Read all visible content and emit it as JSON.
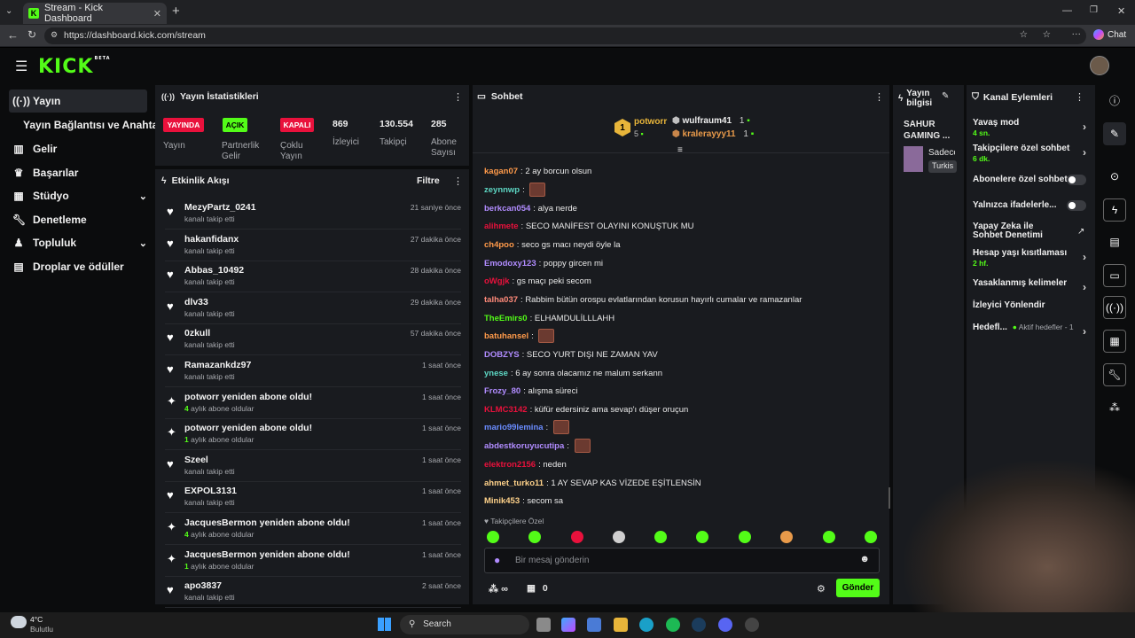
{
  "browser": {
    "tab_title": "Stream - Kick Dashboard",
    "url": "https://dashboard.kick.com/stream",
    "chat_button": "Chat"
  },
  "logo": {
    "text": "KICK",
    "beta": "BETA"
  },
  "sidebar": {
    "items": [
      {
        "label": "Yayın",
        "icon": "broadcast-icon"
      },
      {
        "label": "Yayın Bağlantısı ve Anahtarı",
        "icon": ""
      },
      {
        "label": "Gelir",
        "icon": "bar-chart-icon"
      },
      {
        "label": "Başarılar",
        "icon": "trophy-icon"
      },
      {
        "label": "Stüdyo",
        "icon": "grid-icon"
      },
      {
        "label": "Denetleme",
        "icon": "wrench-icon"
      },
      {
        "label": "Topluluk",
        "icon": "users-icon"
      },
      {
        "label": "Droplar ve ödüller",
        "icon": "gift-icon"
      }
    ]
  },
  "stats": {
    "title": "Yayın İstatistikleri",
    "badges": [
      {
        "badge": "YAYINDA",
        "label": "Yayın",
        "color": "#e9113c"
      },
      {
        "badge": "AÇIK",
        "label": "Partnerlik Gelir",
        "color": "#53fc18"
      },
      {
        "badge": "KAPALI",
        "label": "Çoklu Yayın",
        "color": "#e9113c"
      }
    ],
    "numbers": [
      {
        "value": "869",
        "label": "İzleyici"
      },
      {
        "value": "130.554",
        "label": "Takipçi"
      },
      {
        "value": "285",
        "label": "Abone Sayısı"
      }
    ]
  },
  "activity": {
    "title": "Etkinlik Akışı",
    "filter": "Filtre",
    "events": [
      {
        "name": "MezyPartz_0241",
        "sub": "kanalı takip etti",
        "time": "21 saniye önce",
        "type": "follow"
      },
      {
        "name": "hakanfidanx",
        "sub": "kanalı takip etti",
        "time": "27 dakika önce",
        "type": "follow"
      },
      {
        "name": "Abbas_10492",
        "sub": "kanalı takip etti",
        "time": "28 dakika önce",
        "type": "follow"
      },
      {
        "name": "dlv33",
        "sub": "kanalı takip etti",
        "time": "29 dakika önce",
        "type": "follow"
      },
      {
        "name": "0zkull",
        "sub": "kanalı takip etti",
        "time": "57 dakika önce",
        "type": "follow"
      },
      {
        "name": "Ramazankdz97",
        "sub": "kanalı takip etti",
        "time": "1 saat önce",
        "type": "follow"
      },
      {
        "name": "potworr yeniden abone oldu!",
        "months": "4",
        "sub": "aylık abone oldular",
        "time": "1 saat önce",
        "type": "sub"
      },
      {
        "name": "potworr yeniden abone oldu!",
        "months": "1",
        "sub": "aylık abone oldular",
        "time": "1 saat önce",
        "type": "sub"
      },
      {
        "name": "Szeel",
        "sub": "kanalı takip etti",
        "time": "1 saat önce",
        "type": "follow"
      },
      {
        "name": "EXPOL3131",
        "sub": "kanalı takip etti",
        "time": "1 saat önce",
        "type": "follow"
      },
      {
        "name": "JacquesBermon yeniden abone oldu!",
        "months": "4",
        "sub": "aylık abone oldular",
        "time": "1 saat önce",
        "type": "sub"
      },
      {
        "name": "JacquesBermon yeniden abone oldu!",
        "months": "1",
        "sub": "aylık abone oldular",
        "time": "1 saat önce",
        "type": "sub"
      },
      {
        "name": "apo3837",
        "sub": "kanalı takip etti",
        "time": "2 saat önce",
        "type": "follow"
      }
    ]
  },
  "chat": {
    "title": "Sohbet",
    "leaderboard": {
      "first": {
        "rank": "1",
        "name": "potworr",
        "count": "5"
      },
      "others": [
        {
          "name": "wulfraum41",
          "count": "1"
        },
        {
          "name": "kralerayyy11",
          "count": "1"
        }
      ]
    },
    "messages": [
      {
        "user": "kagan07",
        "text": "2 ay borcun olsun",
        "color": "#ff9a4a"
      },
      {
        "user": "zeynnwp",
        "text": "",
        "color": "#5dd6c3",
        "emote": true
      },
      {
        "user": "berkcan054",
        "text": "alya nerde",
        "color": "#b18cff"
      },
      {
        "user": "alihmete",
        "text": "SECO MANİFEST OLAYINI KONUŞTUK MU",
        "color": "#e9113c"
      },
      {
        "user": "ch4poo",
        "text": "seco gs macı neydi öyle la",
        "color": "#ff9a4a"
      },
      {
        "user": "Emodoxy123",
        "text": "poppy gircen mi",
        "color": "#b18cff"
      },
      {
        "user": "oWgjk",
        "text": "gs maçı peki secom",
        "color": "#e9113c"
      },
      {
        "user": "talha037",
        "text": "Rabbim bütün orospu evlatlarından korusun hayırlı cumalar ve ramazanlar",
        "color": "#ff8a7a"
      },
      {
        "user": "TheEmirs0",
        "text": "ELHAMDULİLLLAHH",
        "color": "#53fc18"
      },
      {
        "user": "batuhansel",
        "text": "",
        "color": "#ff9a4a",
        "emote": true
      },
      {
        "user": "DOBZYS",
        "text": "SECO YURT DIŞI NE ZAMAN YAV",
        "color": "#b18cff"
      },
      {
        "user": "ynese",
        "text": "6 ay sonra olacamız ne malum serkann",
        "color": "#5dd6c3"
      },
      {
        "user": "Frozy_80",
        "text": "alışma süreci",
        "color": "#b18cff"
      },
      {
        "user": "KLMC3142",
        "text": "küfür edersiniz ama sevap'ı düşer oruçun",
        "color": "#e9113c"
      },
      {
        "user": "mario99lemina",
        "text": "",
        "color": "#6a8cff",
        "emote": true
      },
      {
        "user": "abdestkoruyucutipa",
        "text": "",
        "color": "#b18cff",
        "emote": true
      },
      {
        "user": "elektron2156",
        "text": "neden",
        "color": "#e9113c"
      },
      {
        "user": "ahmet_turko11",
        "text": "1 AY SEVAP KAS VİZEDE EŞİTLENSİN",
        "color": "#ffd28a"
      },
      {
        "user": "Minik453",
        "text": "secom sa",
        "color": "#ffd28a"
      }
    ],
    "followers_only": "Takipçilere Özel",
    "input_placeholder": "Bir mesaj gönderin",
    "send_button": "Gönder",
    "points_infinite": "∞",
    "points_count": "0"
  },
  "stream_info": {
    "title": "Yayın bilgisi",
    "stream_title": "SAHUR GAMING ...",
    "category_short": "Sadece",
    "tag": "Turkis"
  },
  "channel_actions": {
    "title": "Kanal Eylemleri",
    "items": [
      {
        "label": "Yavaş mod",
        "sub": "4 sn.",
        "control": "chevron"
      },
      {
        "label": "Takipçilere özel sohbet",
        "sub": "6 dk.",
        "control": "chevron"
      },
      {
        "label": "Abonelere özel sohbet",
        "sub": "",
        "control": "toggle"
      },
      {
        "label": "Yalnızca ifadelerle...",
        "sub": "",
        "control": "toggle"
      },
      {
        "label": "Yapay Zeka ile Sohbet Denetimi",
        "sub": "",
        "control": "external"
      },
      {
        "label": "Hesap yaşı kısıtlaması",
        "sub": "2 hf.",
        "control": "chevron"
      },
      {
        "label": "Yasaklanmış kelimeler",
        "sub": "",
        "control": "chevron"
      },
      {
        "label": "İzleyici Yönlendir",
        "sub": "",
        "control": "none"
      },
      {
        "label": "Hedefl...",
        "sub": "Aktif hedefler - 1",
        "control": "chevron"
      }
    ]
  },
  "taskbar": {
    "weather_temp": "4°C",
    "weather_text": "Bulutlu",
    "search": "Search"
  }
}
